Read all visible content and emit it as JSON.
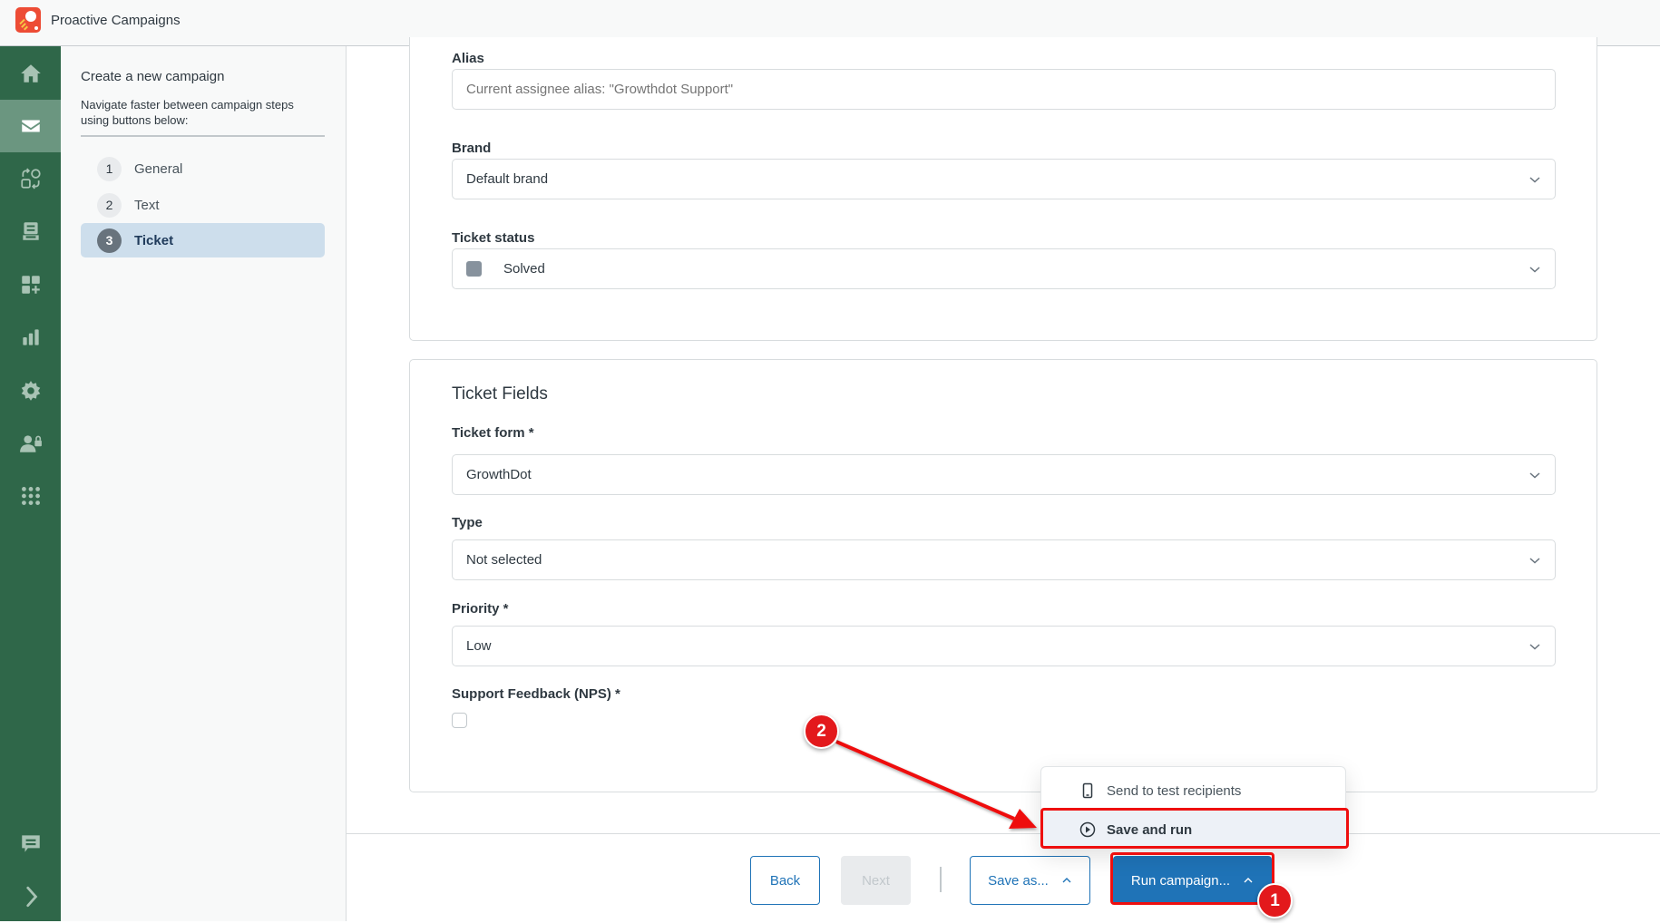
{
  "app": {
    "title": "Proactive Campaigns"
  },
  "rail": {
    "items": [
      {
        "name": "home",
        "icon": "home-icon"
      },
      {
        "name": "campaigns",
        "icon": "mail-icon",
        "active": true
      },
      {
        "name": "automations",
        "icon": "automation-icon"
      },
      {
        "name": "inbox",
        "icon": "inbox-icon"
      },
      {
        "name": "add-widget",
        "icon": "add-widget-icon"
      },
      {
        "name": "reports",
        "icon": "bar-chart-icon"
      },
      {
        "name": "settings",
        "icon": "gear-icon"
      },
      {
        "name": "user-permissions",
        "icon": "user-lock-icon"
      },
      {
        "name": "apps",
        "icon": "apps-grid-icon"
      }
    ],
    "bottom": [
      {
        "name": "chat",
        "icon": "chat-icon"
      },
      {
        "name": "expand",
        "icon": "chevron-right-icon"
      }
    ]
  },
  "steps": {
    "title": "Create a new campaign",
    "description": "Navigate faster between campaign steps using buttons below:",
    "items": [
      {
        "num": "1",
        "label": "General"
      },
      {
        "num": "2",
        "label": "Text"
      },
      {
        "num": "3",
        "label": "Ticket",
        "active": true
      }
    ]
  },
  "ticket": {
    "alias": {
      "label": "Alias",
      "placeholder": "Current assignee alias: \"Growthdot Support\"",
      "value": ""
    },
    "brand": {
      "label": "Brand",
      "value": "Default brand"
    },
    "status": {
      "label": "Ticket status",
      "value": "Solved",
      "color": "#87929d"
    }
  },
  "ticket_fields": {
    "title": "Ticket Fields",
    "form": {
      "label": "Ticket form *",
      "value": "GrowthDot"
    },
    "type": {
      "label": "Type",
      "value": "Not selected"
    },
    "priority": {
      "label": "Priority *",
      "value": "Low"
    },
    "nps": {
      "label": "Support Feedback (NPS) *",
      "checked": false
    }
  },
  "footer": {
    "back": "Back",
    "next": "Next",
    "save_as": "Save as...",
    "run": "Run campaign..."
  },
  "run_menu": {
    "items": [
      {
        "label": "Send to test recipients",
        "icon": "mobile-icon"
      },
      {
        "label": "Save and run",
        "icon": "play-circle-icon",
        "highlighted": true
      }
    ]
  },
  "annotations": {
    "badge1": "1",
    "badge2": "2",
    "color": "#ee0f0f"
  }
}
